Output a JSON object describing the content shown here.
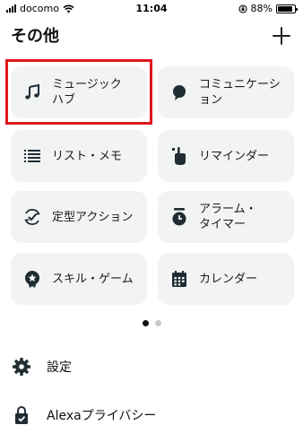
{
  "status_bar": {
    "carrier": "docomo",
    "time": "11:04",
    "battery_percent": 88,
    "battery_label": "88%"
  },
  "header": {
    "title": "その他",
    "add_icon": "plus-icon"
  },
  "tiles": [
    {
      "label": "ミュージック\nハブ",
      "icon": "music-note-icon",
      "highlighted": true
    },
    {
      "label": "コミュニケーシ\nョン",
      "icon": "speech-bubble-icon"
    },
    {
      "label": "リスト・メモ",
      "icon": "list-icon"
    },
    {
      "label": "リマインダー",
      "icon": "reminder-hand-icon"
    },
    {
      "label": "定型アクション",
      "icon": "routine-check-icon"
    },
    {
      "label": "アラーム・\nタイマー",
      "icon": "alarm-clock-icon"
    },
    {
      "label": "スキル・ゲーム",
      "icon": "skill-badge-icon"
    },
    {
      "label": "カレンダー",
      "icon": "calendar-icon"
    }
  ],
  "pager": {
    "pages": 2,
    "current": 1
  },
  "menu": [
    {
      "label": "設定",
      "icon": "gear-icon"
    },
    {
      "label": "Alexaプライバシー",
      "icon": "privacy-lock-icon"
    }
  ],
  "colors": {
    "tile_background": "#f2f3f3",
    "highlight_border": "#e0141c",
    "icon": "#1f2d33"
  }
}
